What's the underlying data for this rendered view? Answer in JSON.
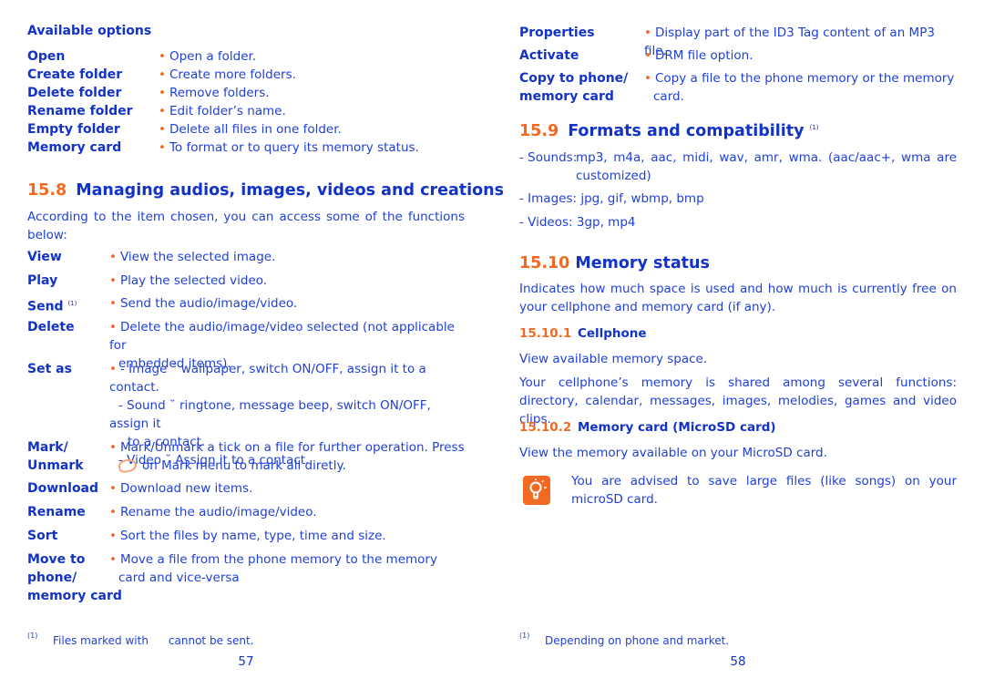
{
  "left_page": {
    "available_options": {
      "heading": "Available options",
      "items": [
        {
          "term": "Open",
          "desc": "Open a folder."
        },
        {
          "term": "Create folder",
          "desc": "Create more folders."
        },
        {
          "term": "Delete folder",
          "desc": "Remove folders."
        },
        {
          "term": "Rename folder",
          "desc": "Edit folder’s name."
        },
        {
          "term": "Empty folder",
          "desc": "Delete all files in one folder."
        },
        {
          "term": "Memory card",
          "desc": "To format or to query its memory status."
        }
      ]
    },
    "section_15_8": {
      "number": "15.8",
      "title": "Managing audios, images, videos and creations",
      "intro": "According to the item chosen, you can access some of the functions below:",
      "items": [
        {
          "term": "View",
          "desc": "View the selected image."
        },
        {
          "term": "Play",
          "desc": "Play the selected video."
        },
        {
          "term": "Send",
          "term_sup": "(1)",
          "desc": "Send the audio/image/video."
        },
        {
          "term": "Delete",
          "desc_line1": "Delete the audio/image/video selected (not applicable for",
          "desc_line2": "embedded items)."
        },
        {
          "term": "Set as",
          "lines": [
            "- Image ˘ wallpaper, switch ON/OFF, assign it to a contact.",
            "- Sound ˘ ringtone, message beep, switch ON/OFF, assign it",
            "to a contact.",
            "- Video ˘ Assign it to a contact."
          ]
        },
        {
          "term_line1": "Mark/",
          "term_line2": "Unmark",
          "desc_line1": "Mark/Unmark a tick on a file for further operation. Press",
          "desc_line2": "on Mark menu to mark all diretly.",
          "icon": "ok-key-icon"
        },
        {
          "term": "Download",
          "desc": "Download new items."
        },
        {
          "term": "Rename",
          "desc": "Rename the audio/image/video."
        },
        {
          "term": "Sort",
          "desc": "Sort the files by name, type, time and size."
        },
        {
          "term_line1": "Move to",
          "term_line2": "phone/",
          "term_line3": "memory card",
          "desc_line1": "Move a file from the phone memory to the memory",
          "desc_line2": "card and vice-versa"
        }
      ]
    },
    "footnote": {
      "mark": "(1)",
      "text_before": "Files marked with",
      "text_after": "cannot be sent."
    },
    "page_number": "57"
  },
  "right_page": {
    "options": [
      {
        "term": "Properties",
        "desc": "Display part of the ID3 Tag content of an MP3 file."
      },
      {
        "term": "Activate",
        "desc": "DRM file option."
      },
      {
        "term_line1": "Copy to phone/",
        "term_line2": "memory card",
        "desc_line1": "Copy a file to the phone memory or the memory",
        "desc_line2": "card."
      }
    ],
    "section_15_9": {
      "number": "15.9",
      "title": "Formats and compatibility",
      "title_sup": "(1)",
      "sounds_label": "- Sounds:",
      "sounds_line1": "mp3, m4a, aac, midi, wav, amr, wma. (aac/aac+, wma are",
      "sounds_line2": "customized)",
      "images": "- Images: jpg, gif, wbmp, bmp",
      "videos": "- Videos: 3gp, mp4"
    },
    "section_15_10": {
      "number": "15.10",
      "title": "Memory status",
      "intro": "Indicates how much space is used and how much is currently free on your cellphone and memory card (if any).",
      "sub1": {
        "number": "15.10.1",
        "title": "Cellphone",
        "p1": "View available memory space.",
        "p2": "Your cellphone’s memory is shared among several functions: directory, calendar, messages, images, melodies, games and video clips."
      },
      "sub2": {
        "number": "15.10.2",
        "title": "Memory card (MicroSD card)",
        "p1": "View the memory available on your MicroSD card."
      },
      "tip": {
        "icon": "lightbulb-tip-icon",
        "text": "You are advised to save large files (like songs) on your microSD card."
      }
    },
    "footnote": {
      "mark": "(1)",
      "text": "Depending on phone and market."
    },
    "page_number": "58"
  },
  "colors": {
    "text_blue": "#1f3fd8",
    "heading_blue": "#1233c6",
    "accent_orange": "#f26a21"
  }
}
